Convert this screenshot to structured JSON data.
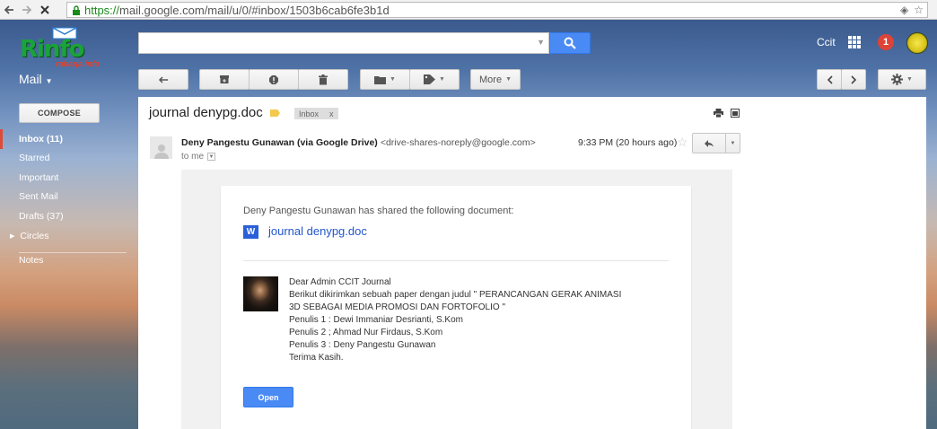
{
  "browser": {
    "url_scheme": "https://",
    "url_rest": "mail.google.com/mail/u/0/#inbox/1503b6cab6fe3b1d"
  },
  "header": {
    "logo_text": "Rinfo",
    "logo_sub": "raharja.info",
    "search": {
      "value": "",
      "placeholder": ""
    },
    "user_name": "Ccit",
    "notification_count": "1"
  },
  "toolbar": {
    "mail_label": "Mail",
    "more_label": "More"
  },
  "sidebar": {
    "compose_label": "COMPOSE",
    "items": [
      {
        "label": "Inbox (11)"
      },
      {
        "label": "Starred"
      },
      {
        "label": "Important"
      },
      {
        "label": "Sent Mail"
      },
      {
        "label": "Drafts (37)"
      },
      {
        "label": "Circles"
      },
      {
        "label": "Notes"
      }
    ]
  },
  "message": {
    "subject": "journal denypg.doc",
    "chip_label": "Inbox",
    "chip_close": "x",
    "sender_name": "Deny Pangestu Gunawan (via Google Drive)",
    "sender_email": "<drive-shares-noreply@google.com>",
    "to": "to me",
    "time": "9:33 PM (20 hours ago)",
    "shared_text": "Deny Pangestu Gunawan has shared the following document:",
    "doc_icon_letter": "W",
    "doc_name": "journal denypg.doc",
    "body_lines": [
      "Dear Admin CCIT Journal",
      "Berikut dikirimkan sebuah paper dengan judul \" PERANCANGAN GERAK ANIMASI",
      "3D SEBAGAI MEDIA PROMOSI DAN FORTOFOLIO \"",
      "Penulis 1 : Dewi Immaniar Desrianti, S.Kom",
      "Penulis 2 ; Ahmad Nur Firdaus, S.Kom",
      "Penulis 3 : Deny Pangestu Gunawan",
      "Terima Kasih."
    ],
    "open_label": "Open"
  },
  "colors": {
    "accent_blue": "#4a8af4",
    "link_blue": "#2255cc",
    "active_marker": "#dd4b39",
    "notification_red": "#db4437",
    "label_yellow": "#f2c94c"
  },
  "icons": [
    "back-arrow-icon",
    "forward-arrow-icon",
    "stop-icon",
    "lock-icon",
    "search-icon",
    "apps-grid-icon",
    "reply-icon",
    "archive-icon",
    "report-spam-icon",
    "trash-icon",
    "folder-icon",
    "tag-icon",
    "chevron-left-icon",
    "chevron-right-icon",
    "gear-icon",
    "print-icon",
    "new-window-icon",
    "star-icon",
    "word-doc-icon"
  ]
}
